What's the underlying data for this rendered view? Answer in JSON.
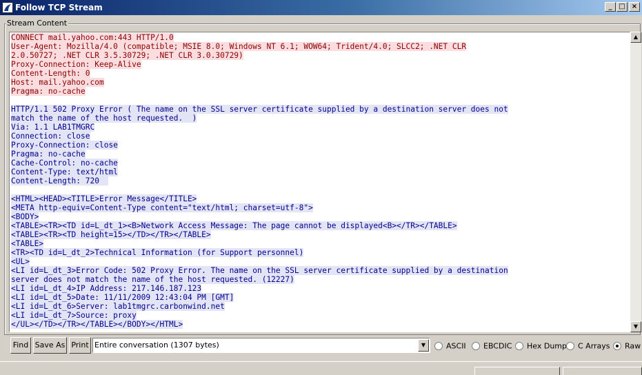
{
  "window": {
    "title": "Follow TCP Stream"
  },
  "group_label": "Stream Content",
  "stream": [
    {
      "t": "c",
      "text": "CONNECT mail.yahoo.com:443 HTTP/1.0"
    },
    {
      "t": "c",
      "text": "User-Agent: Mozilla/4.0 (compatible; MSIE 8.0; Windows NT 6.1; WOW64; Trident/4.0; SLCC2; .NET CLR"
    },
    {
      "t": "c",
      "text": "2.0.50727; .NET CLR 3.5.30729; .NET CLR 3.0.30729)"
    },
    {
      "t": "c",
      "text": "Proxy-Connection: Keep-Alive"
    },
    {
      "t": "c",
      "text": "Content-Length: 0"
    },
    {
      "t": "c",
      "text": "Host: mail.yahoo.com"
    },
    {
      "t": "c",
      "text": "Pragma: no-cache"
    },
    {
      "t": "b",
      "text": ""
    },
    {
      "t": "s",
      "text": "HTTP/1.1 502 Proxy Error ( The name on the SSL server certificate supplied by a destination server does not"
    },
    {
      "t": "s",
      "text": "match the name of the host requested.  )"
    },
    {
      "t": "s",
      "text": "Via: 1.1 LAB1TMGRC"
    },
    {
      "t": "s",
      "text": "Connection: close"
    },
    {
      "t": "s",
      "text": "Proxy-Connection: close"
    },
    {
      "t": "s",
      "text": "Pragma: no-cache"
    },
    {
      "t": "s",
      "text": "Cache-Control: no-cache"
    },
    {
      "t": "s",
      "text": "Content-Type: text/html"
    },
    {
      "t": "s",
      "text": "Content-Length: 720  "
    },
    {
      "t": "b",
      "text": ""
    },
    {
      "t": "s",
      "text": "<HTML><HEAD><TITLE>Error Message</TITLE>"
    },
    {
      "t": "s",
      "text": "<META http-equiv=Content-Type content=\"text/html; charset=utf-8\">"
    },
    {
      "t": "s",
      "text": "<BODY>"
    },
    {
      "t": "s",
      "text": "<TABLE><TR><TD id=L_dt_1><B>Network Access Message: The page cannot be displayed<B></TR></TABLE>"
    },
    {
      "t": "s",
      "text": "<TABLE><TR><TD height=15></TD></TR></TABLE>"
    },
    {
      "t": "s",
      "text": "<TABLE>"
    },
    {
      "t": "s",
      "text": "<TR><TD id=L_dt_2>Technical Information (for Support personnel)"
    },
    {
      "t": "s",
      "text": "<UL>"
    },
    {
      "t": "s",
      "text": "<LI id=L_dt_3>Error Code: 502 Proxy Error. The name on the SSL server certificate supplied by a destination"
    },
    {
      "t": "s",
      "text": "server does not match the name of the host requested. (12227)"
    },
    {
      "t": "s",
      "text": "<LI id=L_dt_4>IP Address: 217.146.187.123"
    },
    {
      "t": "s",
      "text": "<LI id=L_dt_5>Date: 11/11/2009 12:43:04 PM [GMT]"
    },
    {
      "t": "s",
      "text": "<LI id=L_dt_6>Server: lab1tmgrc.carbonwind.net"
    },
    {
      "t": "s",
      "text": "<LI id=L_dt_7>Source: proxy"
    },
    {
      "t": "s",
      "text": "</UL></TD></TR></TABLE></BODY></HTML>"
    }
  ],
  "buttons": {
    "find": "Find",
    "save_as": "Save As",
    "print": "Print"
  },
  "conversation_select": {
    "value": "Entire conversation (1307 bytes)"
  },
  "formats": [
    {
      "label": "ASCII",
      "checked": false
    },
    {
      "label": "EBCDIC",
      "checked": false
    },
    {
      "label": "Hex Dump",
      "checked": false
    },
    {
      "label": "C Arrays",
      "checked": false
    },
    {
      "label": "Raw",
      "checked": true
    }
  ],
  "colors": {
    "client_text": "#8b0000",
    "client_bg": "#fbdde0",
    "server_text": "#00008b",
    "server_bg": "#e4e4f7",
    "titlebar": "#0a246a"
  }
}
